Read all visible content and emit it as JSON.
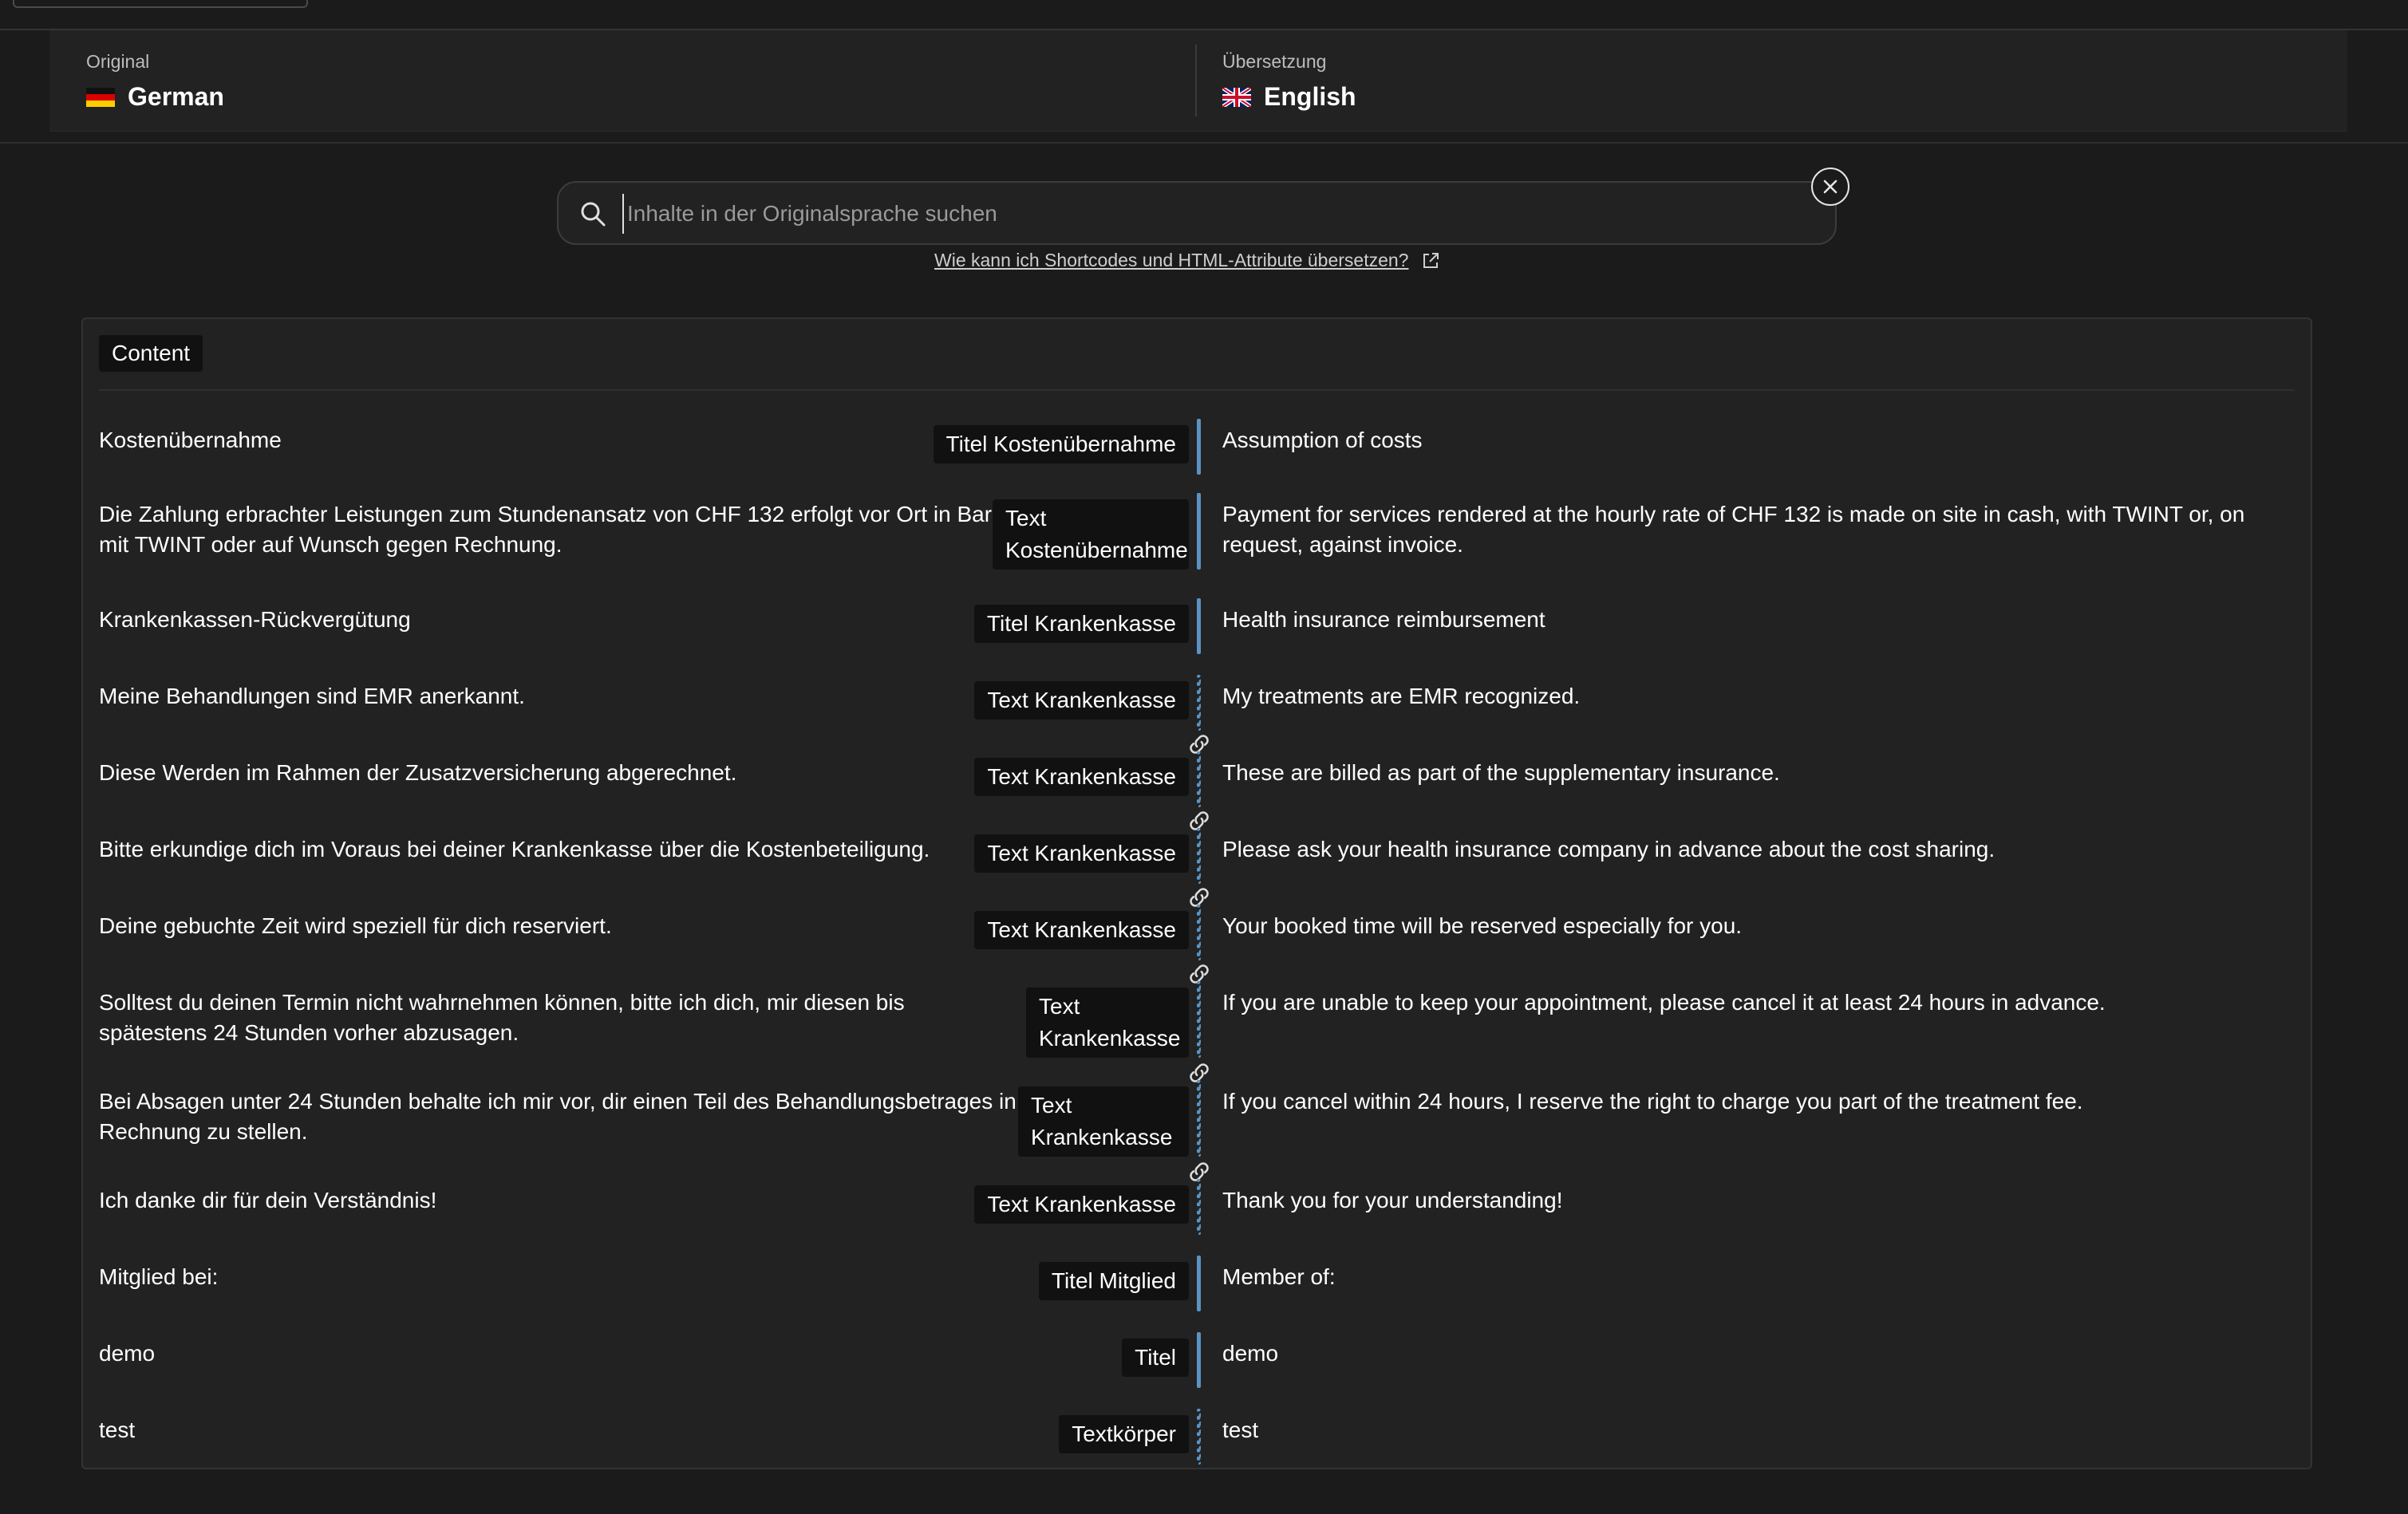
{
  "header": {
    "original_label": "Original",
    "original_lang": "German",
    "translation_label": "Übersetzung",
    "translation_lang": "English"
  },
  "search": {
    "placeholder": "Inhalte in der Originalsprache suchen",
    "help_link": "Wie kann ich Shortcodes und HTML-Attribute übersetzen?"
  },
  "section": {
    "label": "Content"
  },
  "rows": [
    {
      "original": "Kostenübernahme",
      "field": "Titel Kostenübernahme",
      "translation": "Assumption of costs",
      "linked": false
    },
    {
      "original": "Die Zahlung erbrachter Leistungen zum Stundenansatz von CHF 132 erfolgt vor Ort in Bar, mit TWINT oder auf Wunsch gegen Rechnung.",
      "field": "Text Kostenübernahme",
      "translation": "Payment for services rendered at the hourly rate of CHF 132 is made on site in cash, with TWINT or, on request, against invoice.",
      "linked": false
    },
    {
      "original": "Krankenkassen-Rückvergütung",
      "field": "Titel Krankenkasse",
      "translation": "Health insurance reimbursement",
      "linked": false
    },
    {
      "original": "Meine Behandlungen sind EMR anerkannt.",
      "field": "Text Krankenkasse",
      "translation": "My treatments are EMR recognized.",
      "linked": true
    },
    {
      "original": "Diese Werden im Rahmen der Zusatzversicherung abgerechnet.",
      "field": "Text Krankenkasse",
      "translation": "These are billed as part of the supplementary insurance.",
      "linked": true
    },
    {
      "original": "Bitte erkundige dich im Voraus bei deiner Krankenkasse über die Kostenbeteiligung.",
      "field": "Text Krankenkasse",
      "translation": "Please ask your health insurance company in advance about the cost sharing.",
      "linked": true
    },
    {
      "original": "Deine gebuchte Zeit wird speziell für dich reserviert.",
      "field": "Text Krankenkasse",
      "translation": "Your booked time will be reserved especially for you.",
      "linked": true
    },
    {
      "original": "Solltest du deinen Termin nicht wahrnehmen können, bitte ich dich, mir diesen bis spätestens 24 Stunden vorher abzusagen.",
      "field": "Text Krankenkasse",
      "translation": "If you are unable to keep your appointment, please cancel it at least 24 hours in advance.",
      "linked": true
    },
    {
      "original": "Bei Absagen unter 24 Stunden behalte ich mir vor, dir einen Teil des Behandlungsbetrages in Rechnung zu stellen.",
      "field": "Text Krankenkasse",
      "translation": "If you cancel within 24 hours, I reserve the right to charge you part of the treatment fee.",
      "linked": true
    },
    {
      "original": "Ich danke dir für dein Verständnis!",
      "field": "Text Krankenkasse",
      "translation": "Thank you for your understanding!",
      "linked": true
    },
    {
      "original": "Mitglied bei:",
      "field": "Titel Mitglied",
      "translation": "Member of:",
      "linked": false
    },
    {
      "original": "demo",
      "field": "Titel",
      "translation": "demo",
      "linked": false
    },
    {
      "original": "test",
      "field": "Textkörper",
      "translation": "test",
      "linked": true
    }
  ]
}
